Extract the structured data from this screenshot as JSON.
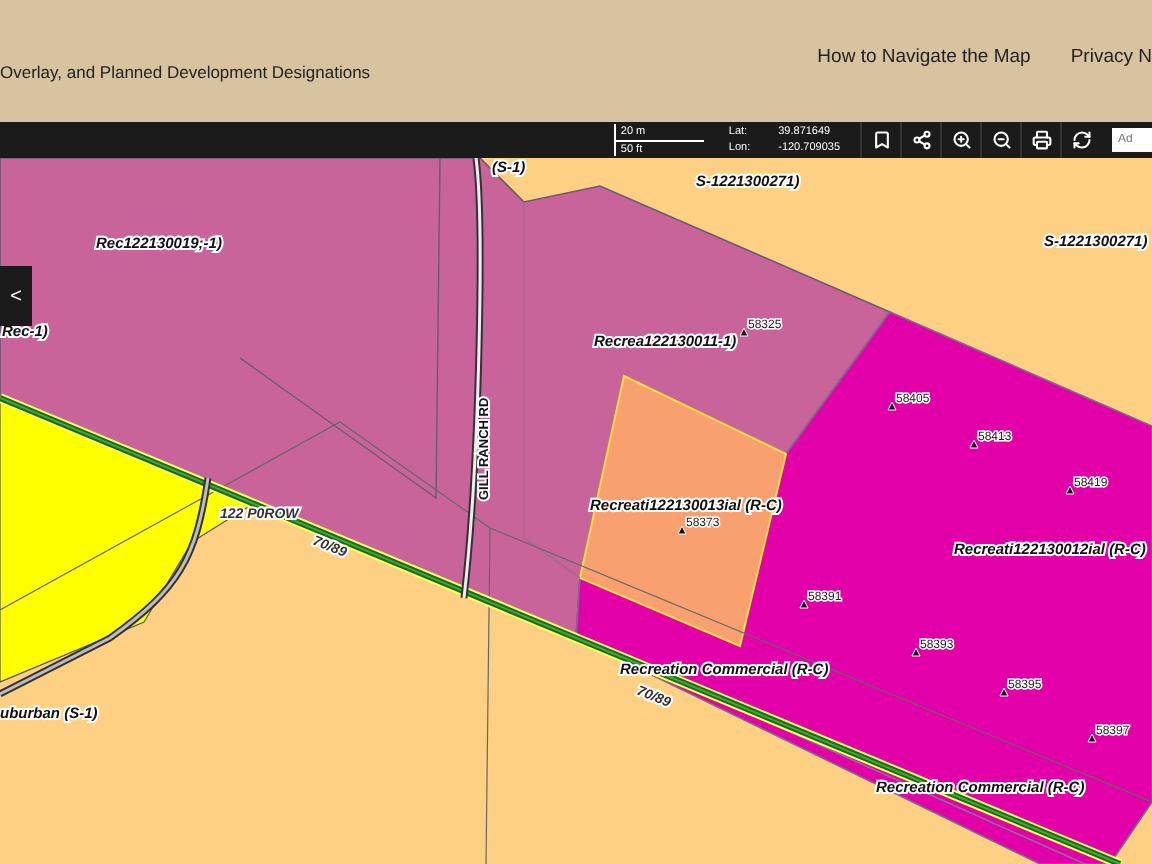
{
  "header": {
    "title": "Overlay, and Planned Development Designations",
    "nav": [
      "How to Navigate the Map",
      "Privacy N"
    ]
  },
  "toolbar": {
    "scale": [
      "20 m",
      "50 ft"
    ],
    "lat_label": "Lat:",
    "lat": "39.871649",
    "lon_label": "Lon:",
    "lon": "-120.709035",
    "tools": [
      {
        "kind": "bookmark"
      },
      {
        "kind": "share"
      },
      {
        "kind": "zoom-in"
      },
      {
        "kind": "zoom-out"
      },
      {
        "kind": "print"
      },
      {
        "kind": "refresh"
      }
    ],
    "search": {
      "placeholder": "Ad"
    },
    "collapse": "<"
  },
  "map": {
    "labels": [
      {
        "kind": "zone",
        "text": "(S-1)"
      },
      {
        "kind": "zone",
        "text": "S-1221300271)"
      },
      {
        "kind": "zone",
        "text": "Rec122130019;-1)"
      },
      {
        "kind": "zone",
        "text": "S-1221300271)"
      },
      {
        "kind": "zone",
        "text": "Rec-1)"
      },
      {
        "kind": "road",
        "text": "GILL RANCH RD"
      },
      {
        "kind": "zone",
        "text": "Recrea122130011-1)"
      },
      {
        "kind": "zone",
        "text": "Recreati122130013ial (R-C)"
      },
      {
        "kind": "zone",
        "text": "Recreati122130012ial (R-C)"
      },
      {
        "kind": "zone",
        "text": "Recreation Commercial (R-C)"
      },
      {
        "kind": "zone",
        "text": "Recreation Commercial (R-C)"
      },
      {
        "kind": "row",
        "text": "70/89"
      },
      {
        "kind": "row",
        "text": "70/89"
      },
      {
        "kind": "row",
        "text": "122 P0ROW"
      },
      {
        "kind": "zone",
        "text": "uburban (S-1)"
      }
    ],
    "points": [
      "58325",
      "58405",
      "58413",
      "58419",
      "58373",
      "58391",
      "58393",
      "58395",
      "58397"
    ]
  }
}
